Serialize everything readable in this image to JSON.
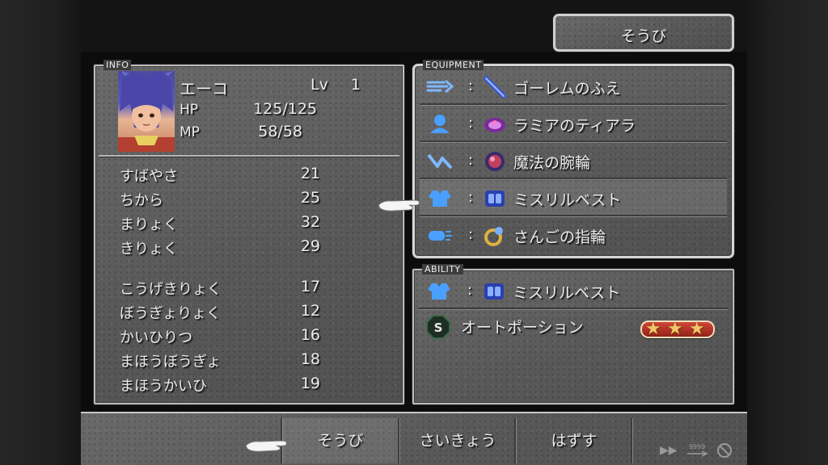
{
  "top_tab": {
    "label": "そうび"
  },
  "info": {
    "title": "INFO",
    "name": "エーコ",
    "lv_label": "Lv",
    "lv": "1",
    "hp_label": "HP",
    "hp": "125/125",
    "mp_label": "MP",
    "mp": "58/58",
    "stats": [
      {
        "label": "すばやさ",
        "value": "21"
      },
      {
        "label": "ちから",
        "value": "25"
      },
      {
        "label": "まりょく",
        "value": "32"
      },
      {
        "label": "きりょく",
        "value": "29"
      },
      {
        "label": "こうげきりょく",
        "value": "17"
      },
      {
        "label": "ぼうぎょりょく",
        "value": "12"
      },
      {
        "label": "かいひりつ",
        "value": "16"
      },
      {
        "label": "まほうぼうぎょ",
        "value": "18"
      },
      {
        "label": "まほうかいひ",
        "value": "19"
      }
    ]
  },
  "equipment": {
    "title": "EQUIPMENT",
    "colon": ":",
    "rows": [
      {
        "slot_icon": "weapon-slot-icon",
        "item_icon": "flute-icon",
        "item": "ゴーレムのふえ"
      },
      {
        "slot_icon": "head-slot-icon",
        "item_icon": "tiara-icon",
        "item": "ラミアのティアラ"
      },
      {
        "slot_icon": "arm-slot-icon",
        "item_icon": "bangle-icon",
        "item": "魔法の腕輪"
      },
      {
        "slot_icon": "body-slot-icon",
        "item_icon": "vest-icon",
        "item": "ミスリルベスト"
      },
      {
        "slot_icon": "accessory-slot-icon",
        "item_icon": "ring-icon",
        "item": "さんごの指輪"
      }
    ],
    "selected_index": 3
  },
  "ability": {
    "title": "ABILITY",
    "item": "ミスリルベスト",
    "skill": "オートポーション",
    "skill_stars": 3
  },
  "commands": [
    "そうび",
    "さいきょう",
    "はずす"
  ],
  "system": {
    "fast_forward_icon": "fast-forward-icon",
    "hp9999_icon": "9999-icon",
    "no-encounter-icon": "no-encounter-icon"
  },
  "colors": {
    "panel_stone": "#5d5d5d",
    "border": "#bdbdbd",
    "text": "#ececec",
    "stars": "#f3c46a"
  }
}
